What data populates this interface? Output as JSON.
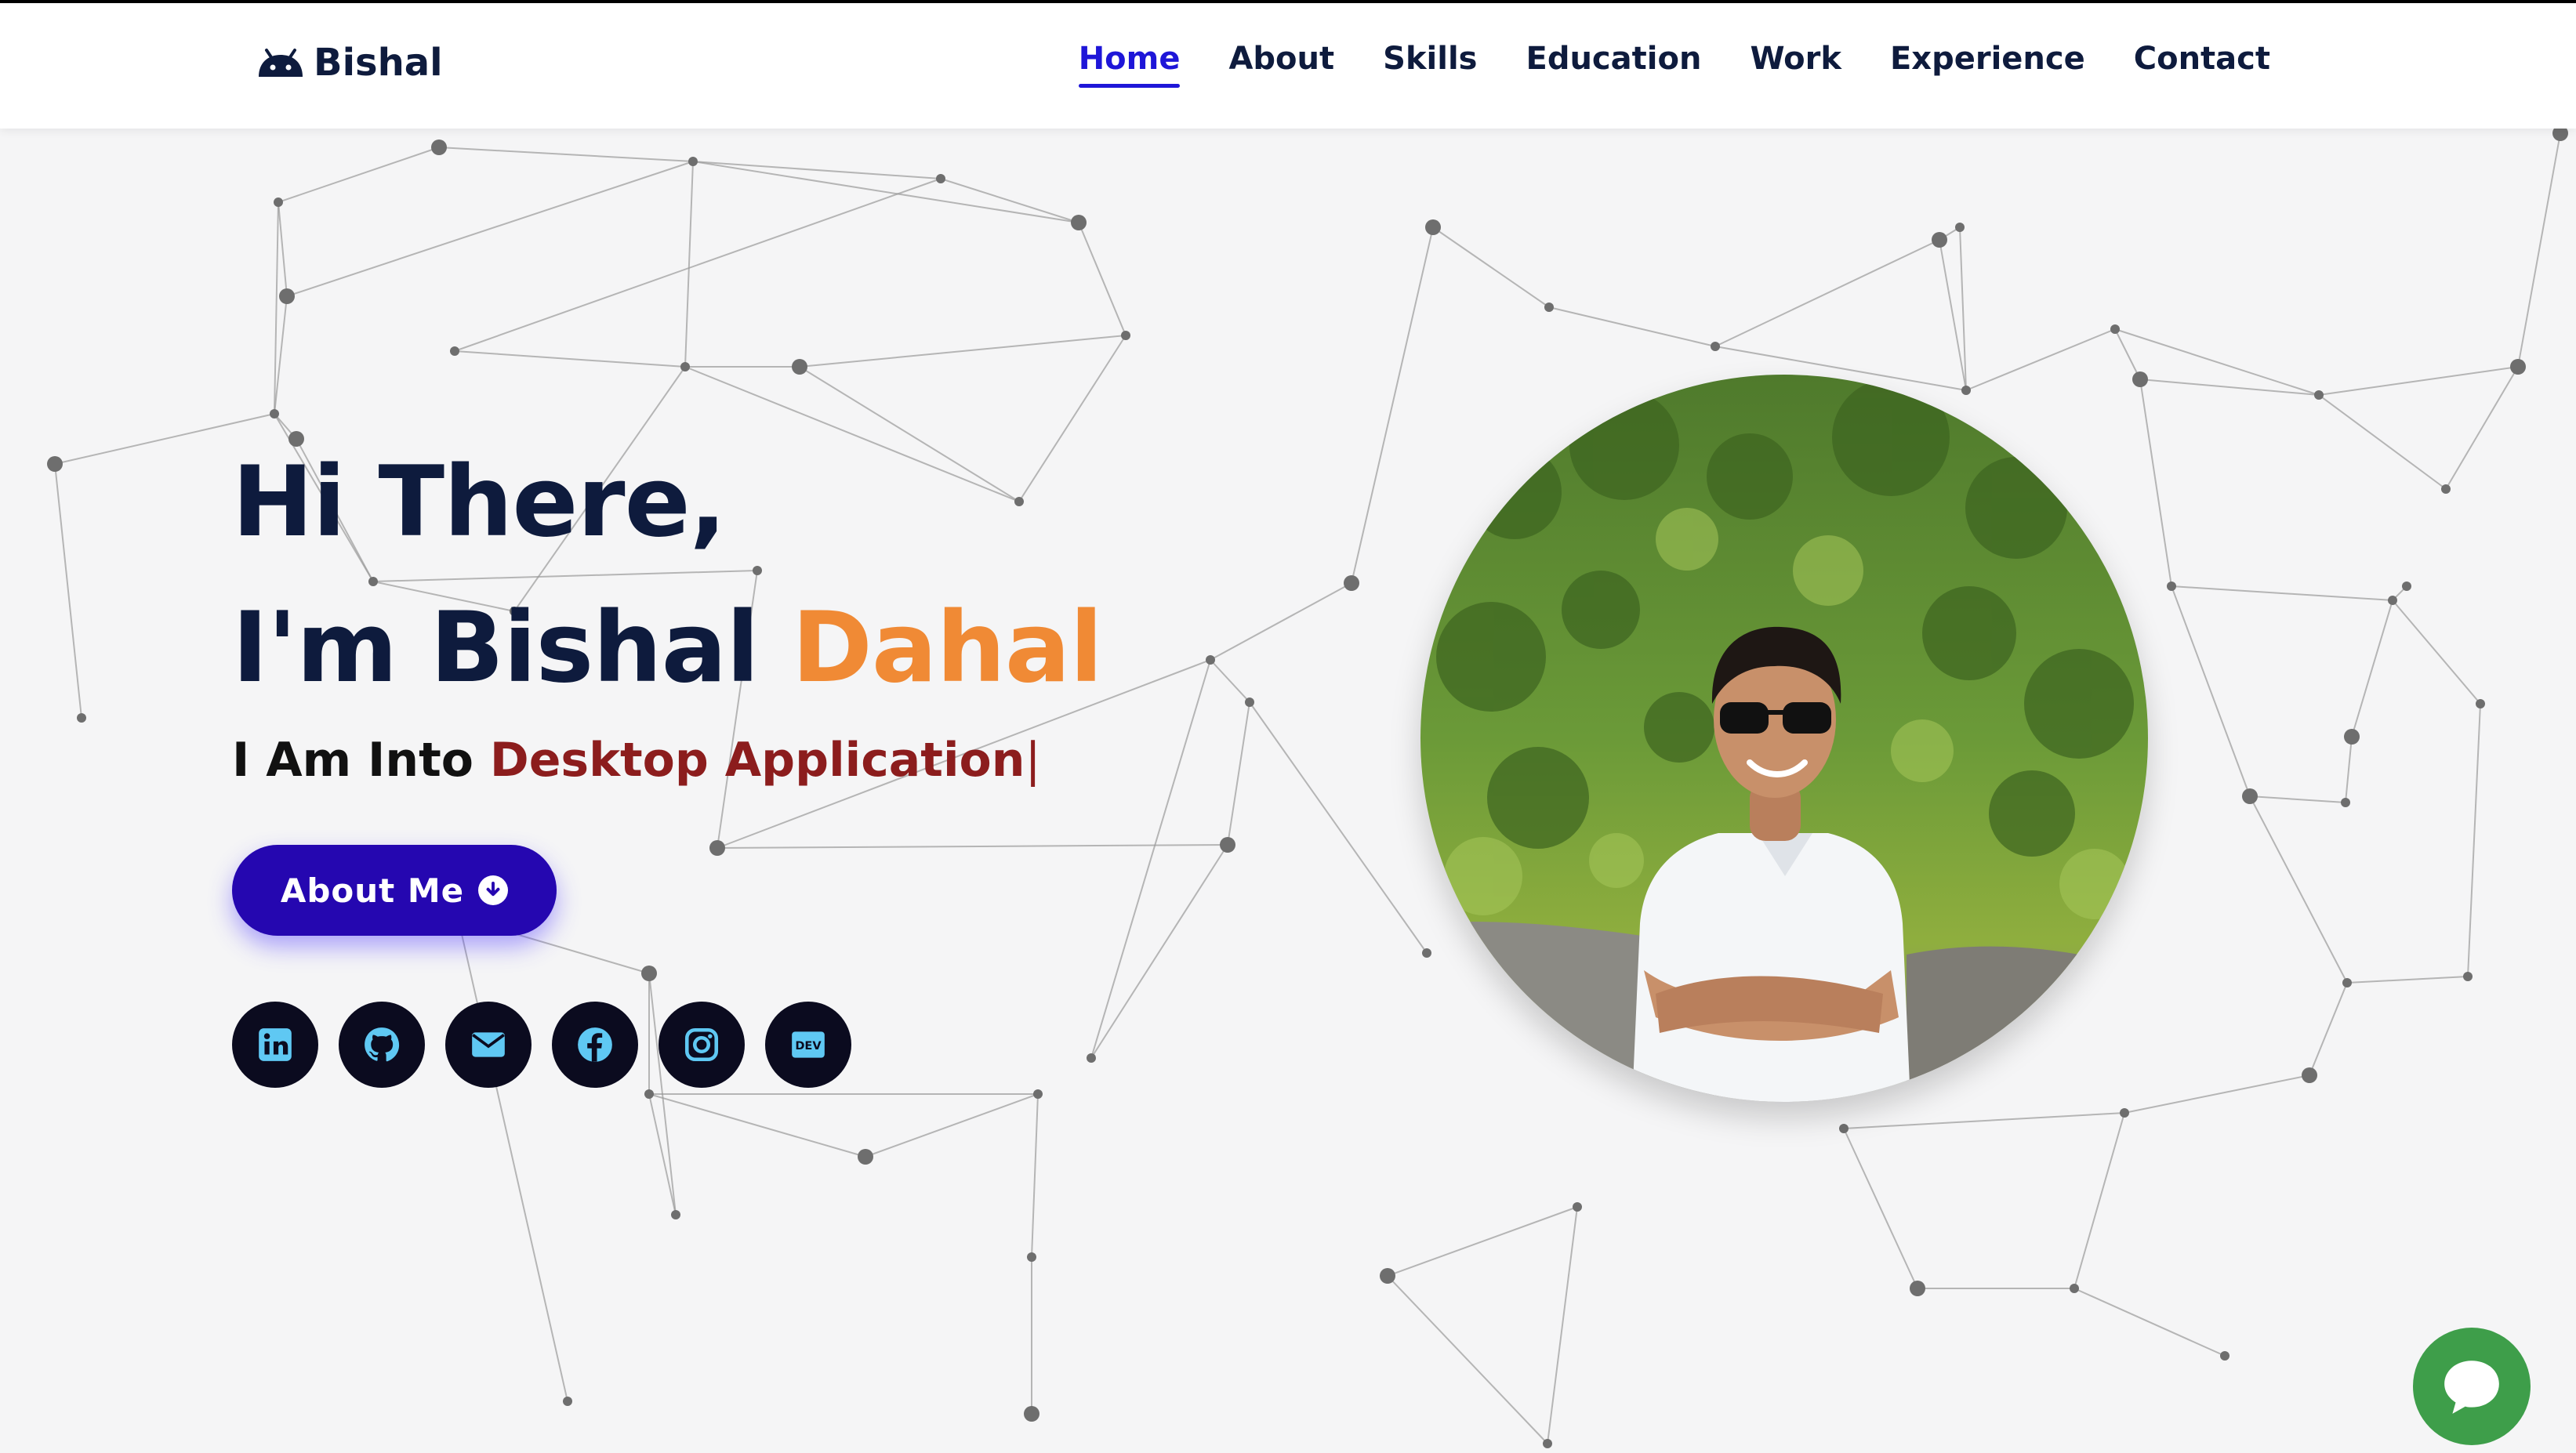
{
  "header": {
    "logo_text": "Bishal",
    "logo_icon": "android-icon",
    "nav": [
      {
        "label": "Home",
        "active": true
      },
      {
        "label": "About",
        "active": false
      },
      {
        "label": "Skills",
        "active": false
      },
      {
        "label": "Education",
        "active": false
      },
      {
        "label": "Work",
        "active": false
      },
      {
        "label": "Experience",
        "active": false
      },
      {
        "label": "Contact",
        "active": false
      }
    ]
  },
  "hero": {
    "greeting": "Hi There,",
    "intro_prefix": "I'm Bishal ",
    "intro_highlight": "Dahal",
    "typed_prefix": "I Am Into ",
    "typed_value": "Desktop Application",
    "typed_cursor": "|",
    "button_label": "About Me",
    "button_icon": "arrow-circle-down-icon"
  },
  "socials": [
    {
      "name": "linkedin-icon"
    },
    {
      "name": "github-icon"
    },
    {
      "name": "envelope-icon"
    },
    {
      "name": "facebook-icon"
    },
    {
      "name": "instagram-icon"
    },
    {
      "name": "dev-icon",
      "label": "DEV"
    }
  ],
  "photo": {
    "subject": "profile photo on green hillside"
  },
  "chat": {
    "icon": "chat-bubble-icon"
  },
  "colors": {
    "navy": "#0e1b3d",
    "accent_blue": "#1e16d8",
    "orange": "#f08a35",
    "dark_red": "#8c1d1d",
    "button": "#2507b0",
    "social_bg": "#0b0b1f",
    "social_icon": "#5fc8f3",
    "chat_green": "#3e9e4a"
  }
}
